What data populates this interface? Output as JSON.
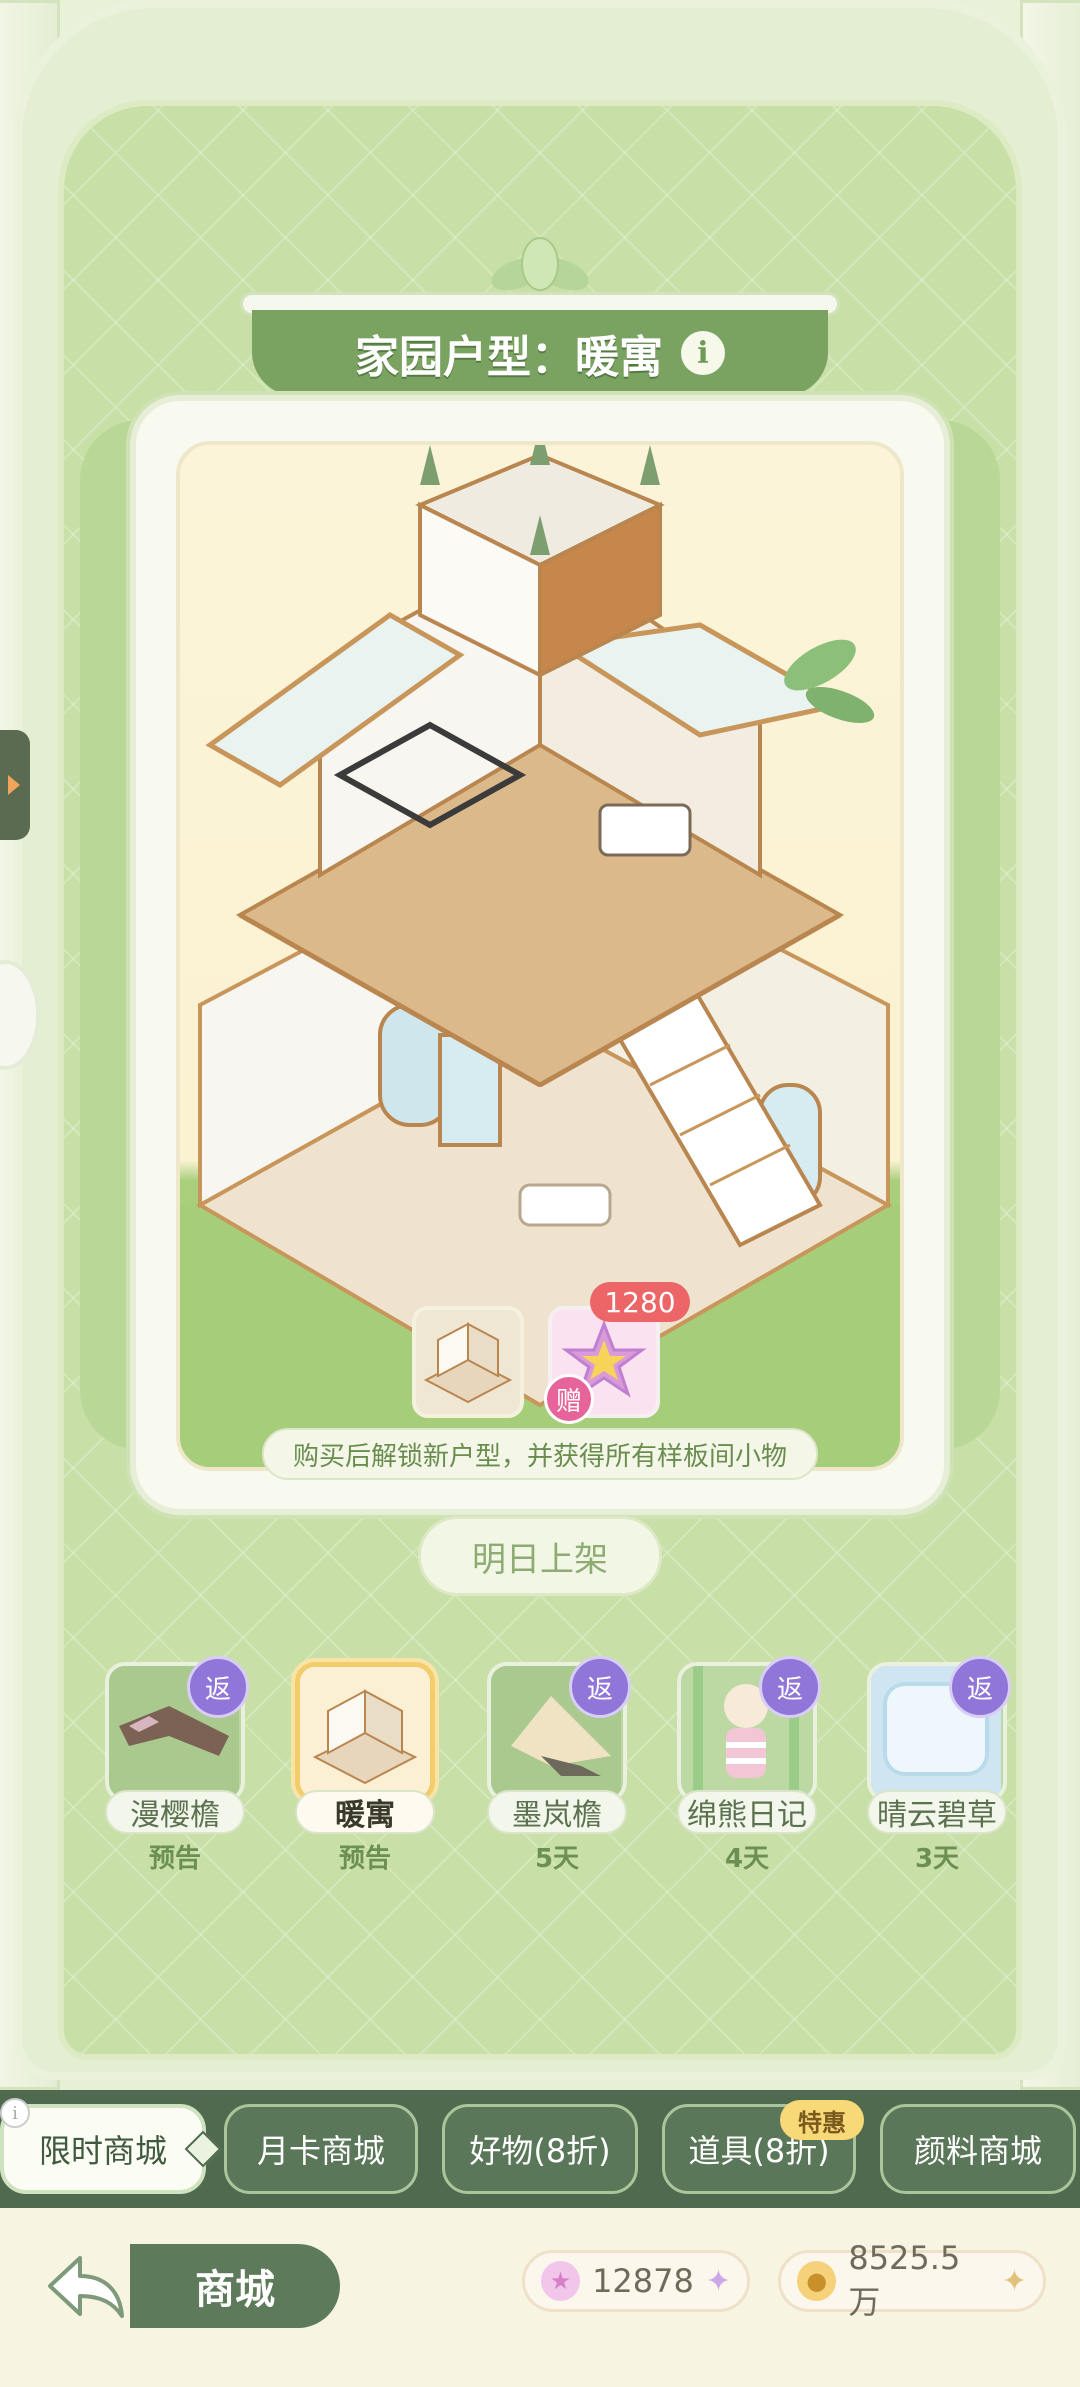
{
  "title": {
    "label": "家园户型：暖寓",
    "info_icon": "info-icon"
  },
  "preview": {
    "bonus_count": "1280",
    "gift_label": "赠",
    "unlock_note": "购买后解锁新户型，并获得所有样板间小物",
    "release_label": "明日上架"
  },
  "items": [
    {
      "name": "漫樱檐",
      "sub": "预告",
      "badge": "返",
      "selected": false
    },
    {
      "name": "暖寓",
      "sub": "预告",
      "badge": "",
      "selected": true
    },
    {
      "name": "墨岚檐",
      "sub": "5天",
      "badge": "返",
      "selected": false
    },
    {
      "name": "绵熊日记",
      "sub": "4天",
      "badge": "返",
      "selected": false
    },
    {
      "name": "晴云碧草",
      "sub": "3天",
      "badge": "返",
      "selected": false
    }
  ],
  "tabs": [
    {
      "label": "限时商城",
      "active": true
    },
    {
      "label": "月卡商城",
      "active": false
    },
    {
      "label": "好物(8折)",
      "active": false
    },
    {
      "label": "道具(8折)",
      "active": false
    },
    {
      "label": "颜料商城",
      "active": false
    }
  ],
  "special_badge": "特惠",
  "bottom": {
    "shop_label": "商城",
    "stars": "12878",
    "coins": "8525.5万"
  },
  "colors": {
    "accent_green": "#7aa261",
    "tabbar": "#4f6a4f",
    "return_badge": "#8f76d8",
    "bonus_badge": "#ec6667"
  }
}
